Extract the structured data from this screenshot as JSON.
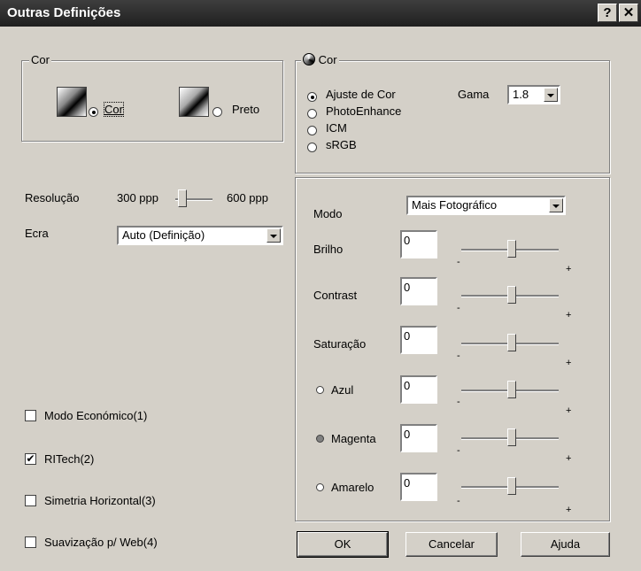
{
  "window": {
    "title": "Outras Definições",
    "help_glyph": "?",
    "close_glyph": "✕"
  },
  "cor_group": {
    "legend": "Cor",
    "cor_label": "Cor",
    "preto_label": "Preto"
  },
  "resolucao": {
    "label": "Resolução",
    "low": "300 ppp",
    "high": "600 ppp",
    "value_fraction": 0.0
  },
  "ecra": {
    "label": "Ecra",
    "value": "Auto (Definição)"
  },
  "checkboxes": [
    {
      "label": "Modo Económico(1)",
      "checked": false
    },
    {
      "label": "RITech(2)",
      "checked": true
    },
    {
      "label": "Simetria Horizontal(3)",
      "checked": false
    },
    {
      "label": "Suavização p/ Web(4)",
      "checked": false
    }
  ],
  "color_group": {
    "legend": "Cor",
    "options": [
      "Ajuste de Cor",
      "PhotoEnhance",
      "ICM",
      "sRGB"
    ],
    "selected": "Ajuste de Cor",
    "gama_label": "Gama",
    "gama_value": "1.8"
  },
  "adjust": {
    "modo_label": "Modo",
    "modo_value": "Mais Fotográfico",
    "rows": [
      {
        "label": "Brilho",
        "value": "0"
      },
      {
        "label": "Contrast",
        "value": "0"
      },
      {
        "label": "Saturação",
        "value": "0"
      },
      {
        "label": "Azul",
        "value": "0"
      },
      {
        "label": "Magenta",
        "value": "0"
      },
      {
        "label": "Amarelo",
        "value": "0"
      }
    ],
    "minus": "-",
    "plus": "+"
  },
  "buttons": {
    "ok": "OK",
    "cancel": "Cancelar",
    "help": "Ajuda"
  },
  "colors": {
    "titlebar": "#2a2a2a",
    "face": "#d4d0c8"
  }
}
